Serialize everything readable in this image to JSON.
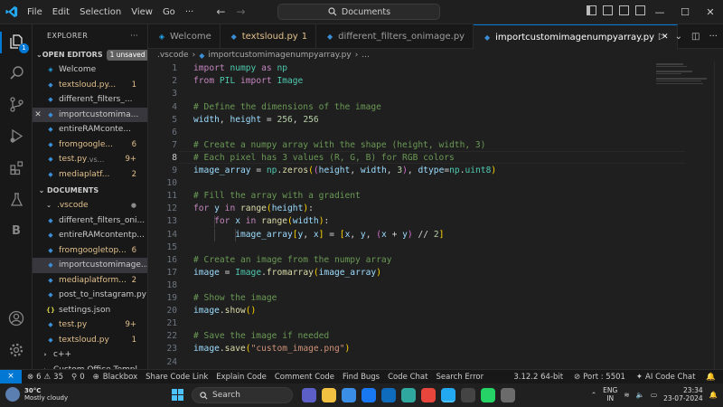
{
  "menu": [
    "File",
    "Edit",
    "Selection",
    "View",
    "Go",
    "···"
  ],
  "command_center": "Documents",
  "window_controls": {
    "minimize": "—",
    "maximize": "☐",
    "close": "✕"
  },
  "explorer": {
    "title": "EXPLORER",
    "open_editors": {
      "label": "OPEN EDITORS",
      "unsaved": "1 unsaved",
      "items": [
        {
          "icon": "vscode-icon",
          "name": "Welcome",
          "count": "",
          "color": "#cccccc"
        },
        {
          "icon": "PY",
          "name": "textsloud.py...",
          "count": "1",
          "color": "#e2c08d"
        },
        {
          "icon": "PY",
          "name": "different_filters_...",
          "count": "",
          "color": "#cccccc"
        },
        {
          "icon": "PY",
          "name": "importcustomima...",
          "count": "",
          "color": "#cccccc"
        },
        {
          "icon": "PY",
          "name": "entireRAMconte...",
          "count": "",
          "color": "#cccccc"
        },
        {
          "icon": "PY",
          "name": "fromgoogle...",
          "count": "6",
          "color": "#e2c08d"
        },
        {
          "icon": "PY",
          "name": "test.py",
          "suffix": ".vs...",
          "count": "9+",
          "color": "#e2c08d"
        },
        {
          "icon": "PY",
          "name": "mediaplatf...",
          "count": "2",
          "color": "#e2c08d"
        }
      ]
    },
    "documents": {
      "label": "DOCUMENTS",
      "items": [
        {
          "icon": "folder",
          "name": ".vscode",
          "count": "",
          "color": "#e2c08d"
        },
        {
          "icon": "PY",
          "name": "different_filters_oni...",
          "count": "",
          "color": "#cccccc"
        },
        {
          "icon": "PY",
          "name": "entireRAMcontentp...",
          "count": "",
          "color": "#cccccc"
        },
        {
          "icon": "PY",
          "name": "fromgoogletop...",
          "count": "6",
          "color": "#e2c08d"
        },
        {
          "icon": "PY",
          "name": "importcustomimage...",
          "count": "",
          "color": "#cccccc"
        },
        {
          "icon": "PY",
          "name": "mediaplatform...",
          "count": "2",
          "color": "#e2c08d"
        },
        {
          "icon": "PY",
          "name": "post_to_instagram.py",
          "count": "",
          "color": "#cccccc"
        },
        {
          "icon": "{}",
          "name": "settings.json",
          "count": "",
          "color": "#cccccc"
        },
        {
          "icon": "PY",
          "name": "test.py",
          "count": "9+",
          "color": "#e2c08d"
        },
        {
          "icon": "PY",
          "name": "textsloud.py",
          "count": "1",
          "color": "#e2c08d"
        },
        {
          "icon": "folder",
          "name": "c++",
          "count": "",
          "color": "#cccccc"
        },
        {
          "icon": "folder",
          "name": "Custom Office Templ...",
          "count": "",
          "color": "#cccccc"
        }
      ]
    }
  },
  "tabs": [
    {
      "icon": "vscode-icon",
      "label": "Welcome",
      "count": "",
      "active": false
    },
    {
      "icon": "python-icon",
      "label": "textsloud.py",
      "count": "1",
      "active": false
    },
    {
      "icon": "python-icon",
      "label": "different_filters_onimage.py",
      "count": "",
      "active": false
    },
    {
      "icon": "python-icon",
      "label": "importcustomimagenumpyarray.py",
      "count": "",
      "active": true
    }
  ],
  "breadcrumb": [
    ".vscode",
    "importcustomimagenumpyarray.py",
    "..."
  ],
  "code_lines": [
    [
      [
        "kw",
        "import"
      ],
      [
        "pl",
        " "
      ],
      [
        "cls",
        "numpy"
      ],
      [
        "pl",
        " "
      ],
      [
        "kw",
        "as"
      ],
      [
        "pl",
        " "
      ],
      [
        "cls",
        "np"
      ]
    ],
    [
      [
        "kw",
        "from"
      ],
      [
        "pl",
        " "
      ],
      [
        "cls",
        "PIL"
      ],
      [
        "pl",
        " "
      ],
      [
        "kw",
        "import"
      ],
      [
        "pl",
        " "
      ],
      [
        "cls",
        "Image"
      ]
    ],
    [],
    [
      [
        "cm",
        "# Define the dimensions of the image"
      ]
    ],
    [
      [
        "var",
        "width"
      ],
      [
        "pl",
        ", "
      ],
      [
        "var",
        "height"
      ],
      [
        "pl",
        " = "
      ],
      [
        "num",
        "256"
      ],
      [
        "pl",
        ", "
      ],
      [
        "num",
        "256"
      ]
    ],
    [],
    [
      [
        "cm",
        "# Create a numpy array with the shape (height, width, 3)"
      ]
    ],
    [
      [
        "cm",
        "# Each pixel has 3 values (R, G, B) for RGB colors"
      ]
    ],
    [
      [
        "var",
        "image_array"
      ],
      [
        "pl",
        " = "
      ],
      [
        "cls",
        "np"
      ],
      [
        "pl",
        "."
      ],
      [
        "fn",
        "zeros"
      ],
      [
        "br1",
        "("
      ],
      [
        "br2",
        "("
      ],
      [
        "var",
        "height"
      ],
      [
        "pl",
        ", "
      ],
      [
        "var",
        "width"
      ],
      [
        "pl",
        ", "
      ],
      [
        "num",
        "3"
      ],
      [
        "br2",
        ")"
      ],
      [
        "pl",
        ", "
      ],
      [
        "var",
        "dtype"
      ],
      [
        "pl",
        "="
      ],
      [
        "cls",
        "np"
      ],
      [
        "pl",
        "."
      ],
      [
        "cls",
        "uint8"
      ],
      [
        "br1",
        ")"
      ]
    ],
    [],
    [
      [
        "cm",
        "# Fill the array with a gradient"
      ]
    ],
    [
      [
        "kw",
        "for"
      ],
      [
        "pl",
        " "
      ],
      [
        "var",
        "y"
      ],
      [
        "pl",
        " "
      ],
      [
        "kw",
        "in"
      ],
      [
        "pl",
        " "
      ],
      [
        "fn",
        "range"
      ],
      [
        "br1",
        "("
      ],
      [
        "var",
        "height"
      ],
      [
        "br1",
        ")"
      ],
      [
        "pl",
        ":"
      ]
    ],
    [
      [
        "pl",
        "    "
      ],
      [
        "kw",
        "for"
      ],
      [
        "pl",
        " "
      ],
      [
        "var",
        "x"
      ],
      [
        "pl",
        " "
      ],
      [
        "kw",
        "in"
      ],
      [
        "pl",
        " "
      ],
      [
        "fn",
        "range"
      ],
      [
        "br1",
        "("
      ],
      [
        "var",
        "width"
      ],
      [
        "br1",
        ")"
      ],
      [
        "pl",
        ":"
      ]
    ],
    [
      [
        "pl",
        "        "
      ],
      [
        "var",
        "image_array"
      ],
      [
        "br1",
        "["
      ],
      [
        "var",
        "y"
      ],
      [
        "pl",
        ", "
      ],
      [
        "var",
        "x"
      ],
      [
        "br1",
        "]"
      ],
      [
        "pl",
        " = "
      ],
      [
        "br1",
        "["
      ],
      [
        "var",
        "x"
      ],
      [
        "pl",
        ", "
      ],
      [
        "var",
        "y"
      ],
      [
        "pl",
        ", "
      ],
      [
        "br2",
        "("
      ],
      [
        "var",
        "x"
      ],
      [
        "pl",
        " + "
      ],
      [
        "var",
        "y"
      ],
      [
        "br2",
        ")"
      ],
      [
        "pl",
        " // "
      ],
      [
        "num",
        "2"
      ],
      [
        "br1",
        "]"
      ]
    ],
    [],
    [
      [
        "cm",
        "# Create an image from the numpy array"
      ]
    ],
    [
      [
        "var",
        "image"
      ],
      [
        "pl",
        " = "
      ],
      [
        "cls",
        "Image"
      ],
      [
        "pl",
        "."
      ],
      [
        "fn",
        "fromarray"
      ],
      [
        "br1",
        "("
      ],
      [
        "var",
        "image_array"
      ],
      [
        "br1",
        ")"
      ]
    ],
    [],
    [
      [
        "cm",
        "# Show the image"
      ]
    ],
    [
      [
        "var",
        "image"
      ],
      [
        "pl",
        "."
      ],
      [
        "fn",
        "show"
      ],
      [
        "br1",
        "()"
      ]
    ],
    [],
    [
      [
        "cm",
        "# Save the image if needed"
      ]
    ],
    [
      [
        "var",
        "image"
      ],
      [
        "pl",
        "."
      ],
      [
        "fn",
        "save"
      ],
      [
        "br1",
        "("
      ],
      [
        "str",
        "\"custom_image.png\""
      ],
      [
        "br1",
        ")"
      ]
    ],
    []
  ],
  "current_line": 8,
  "status": {
    "errors": "6",
    "warnings": "35",
    "ports_count": "0",
    "items": [
      "Blackbox",
      "Share Code Link",
      "Explain Code",
      "Comment Code",
      "Find Bugs",
      "Code Chat",
      "Search Error"
    ],
    "python_version": "3.12.2 64-bit",
    "port": "Port : 5501",
    "ai_chat": "AI Code Chat"
  },
  "taskbar": {
    "temperature": "30°C",
    "weather": "Mostly cloudy",
    "search": "Search",
    "lang_line1": "ENG",
    "lang_line2": "IN",
    "time": "23:34",
    "date": "23-07-2024",
    "apps": [
      {
        "name": "teams-icon",
        "color": "#5b5fc7"
      },
      {
        "name": "file-explorer-icon",
        "color": "#f3c141"
      },
      {
        "name": "photos-icon",
        "color": "#3a8ee6"
      },
      {
        "name": "facebook-icon",
        "color": "#1877f2"
      },
      {
        "name": "outlook-icon",
        "color": "#0f6cbd"
      },
      {
        "name": "edge-icon",
        "color": "#2fa8a0"
      },
      {
        "name": "chrome-icon",
        "color": "#e8453c"
      },
      {
        "name": "vscode-taskbar-icon",
        "color": "#23a9f2"
      },
      {
        "name": "terminal-icon",
        "color": "#444444"
      },
      {
        "name": "whatsapp-icon",
        "color": "#25d366"
      },
      {
        "name": "settings-icon",
        "color": "#6b6b6b"
      }
    ]
  }
}
